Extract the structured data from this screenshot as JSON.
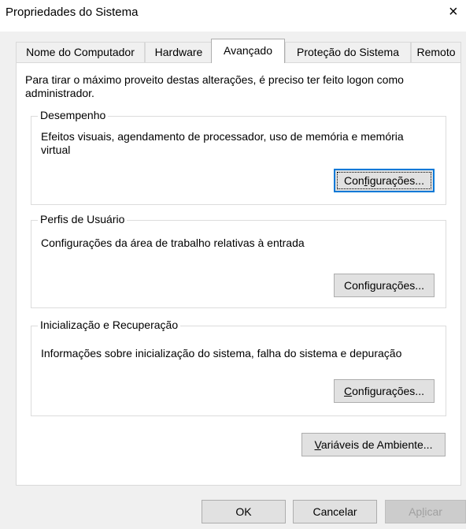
{
  "window": {
    "title": "Propriedades do Sistema",
    "close_glyph": "×"
  },
  "tabs": [
    {
      "label": "Nome do Computador"
    },
    {
      "label": "Hardware"
    },
    {
      "label": "Avançado",
      "active": true
    },
    {
      "label": "Proteção do Sistema"
    },
    {
      "label": "Remoto"
    }
  ],
  "notice": "Para tirar o máximo proveito destas alterações, é preciso ter feito logon como administrador.",
  "groups": {
    "performance": {
      "title": "Desempenho",
      "description": "Efeitos visuais, agendamento de processador, uso de memória e memória virtual",
      "button": {
        "pre": "Con",
        "mnemonic": "f",
        "post": "igurações..."
      }
    },
    "profiles": {
      "title": "Perfis de Usuário",
      "description": "Configurações da área de trabalho relativas à entrada",
      "button": {
        "pre": "Confi",
        "mnemonic": "g",
        "post": "urações..."
      }
    },
    "startup": {
      "title": "Inicialização e Recuperação",
      "description": "Informações sobre inicialização do sistema, falha do sistema e depuração",
      "button": {
        "pre": "",
        "mnemonic": "C",
        "post": "onfigurações..."
      }
    }
  },
  "env_button": {
    "pre": "",
    "mnemonic": "V",
    "post": "ariáveis de Ambiente..."
  },
  "footer": {
    "ok": "OK",
    "cancel": "Cancelar",
    "apply": {
      "pre": "Ap",
      "mnemonic": "l",
      "post": "icar"
    }
  }
}
